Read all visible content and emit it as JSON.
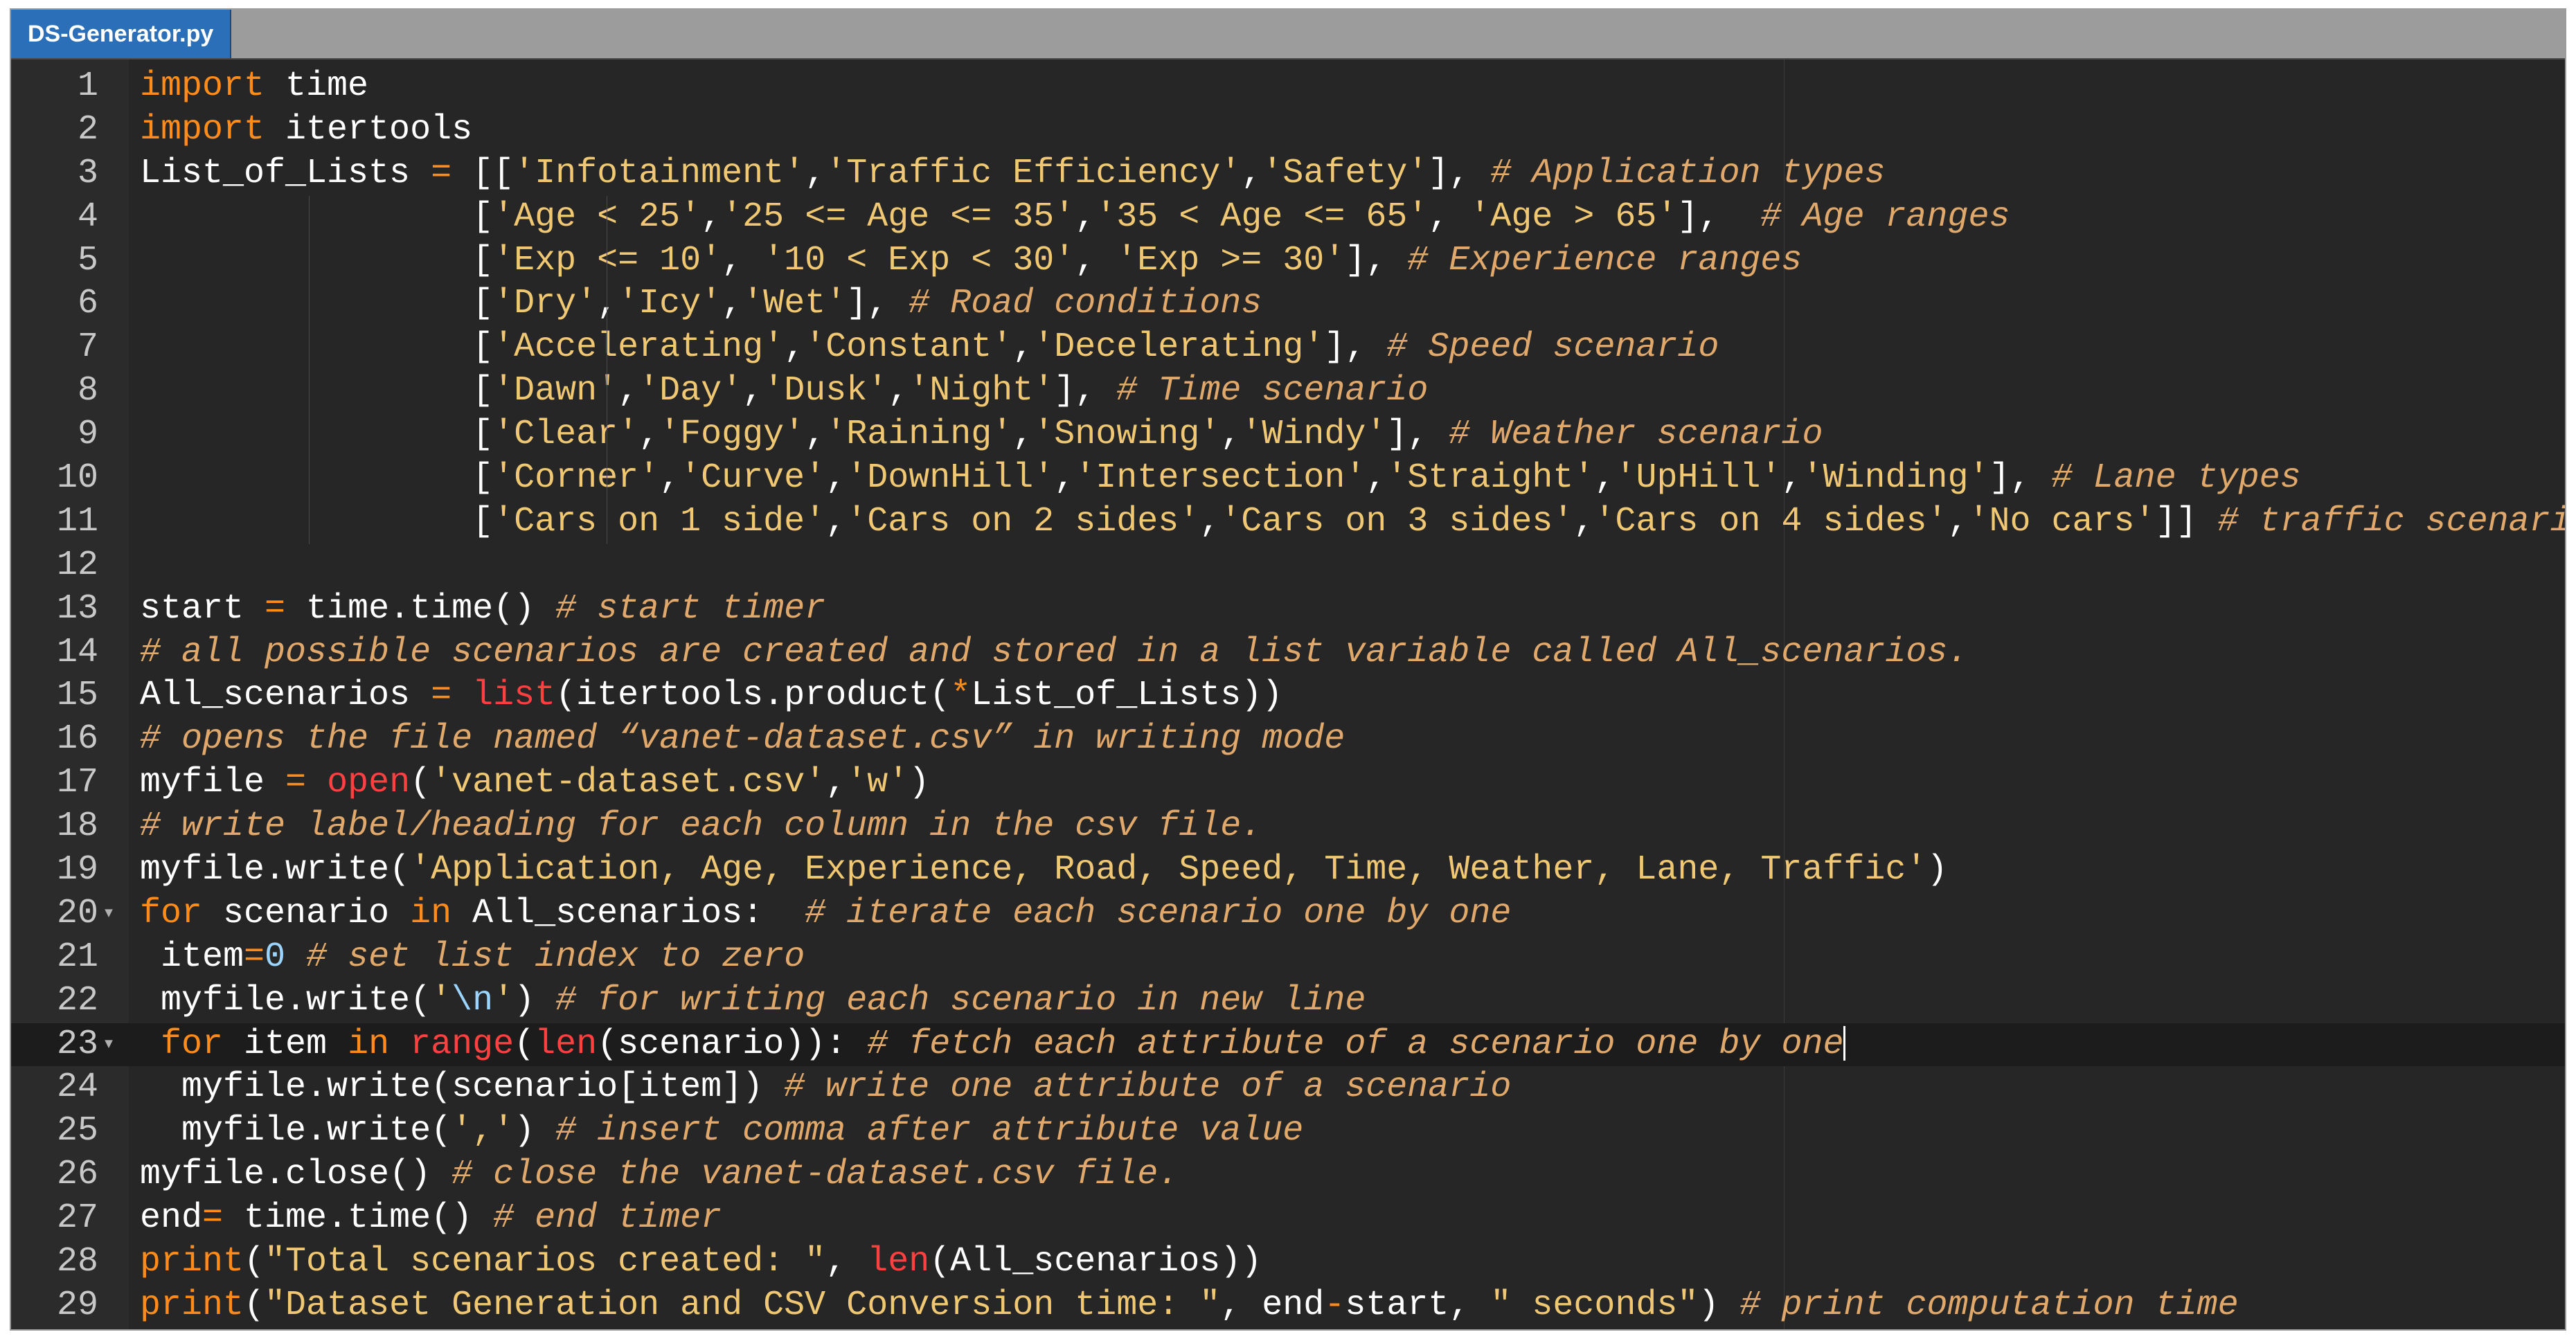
{
  "tab": {
    "filename": "DS-Generator.py"
  },
  "colors": {
    "keyword": "#ff8c1a",
    "string": "#f0c873",
    "comment": "#e0a86b",
    "builtin": "#ff4040",
    "number": "#9ad4ff",
    "background": "#262626",
    "tab_active": "#2a6fb8"
  },
  "editor": {
    "current_line": 23,
    "fold_markers": [
      20,
      23
    ],
    "lines": [
      [
        {
          "t": "import",
          "c": "kw"
        },
        {
          "t": " time"
        }
      ],
      [
        {
          "t": "import",
          "c": "kw"
        },
        {
          "t": " itertools"
        }
      ],
      [
        {
          "t": "List_of_Lists "
        },
        {
          "t": "=",
          "c": "op"
        },
        {
          "t": " [["
        },
        {
          "t": "'Infotainment'",
          "c": "str"
        },
        {
          "t": ","
        },
        {
          "t": "'Traffic Efficiency'",
          "c": "str"
        },
        {
          "t": ","
        },
        {
          "t": "'Safety'",
          "c": "str"
        },
        {
          "t": "], "
        },
        {
          "t": "# Application types",
          "c": "com"
        }
      ],
      [
        {
          "t": "                ["
        },
        {
          "t": "'Age < 25'",
          "c": "str"
        },
        {
          "t": ","
        },
        {
          "t": "'25 <= Age <= 35'",
          "c": "str"
        },
        {
          "t": ","
        },
        {
          "t": "'35 < Age <= 65'",
          "c": "str"
        },
        {
          "t": ", "
        },
        {
          "t": "'Age > 65'",
          "c": "str"
        },
        {
          "t": "],  "
        },
        {
          "t": "# Age ranges",
          "c": "com"
        }
      ],
      [
        {
          "t": "                ["
        },
        {
          "t": "'Exp <= 10'",
          "c": "str"
        },
        {
          "t": ", "
        },
        {
          "t": "'10 < Exp < 30'",
          "c": "str"
        },
        {
          "t": ", "
        },
        {
          "t": "'Exp >= 30'",
          "c": "str"
        },
        {
          "t": "], "
        },
        {
          "t": "# Experience ranges",
          "c": "com"
        }
      ],
      [
        {
          "t": "                ["
        },
        {
          "t": "'Dry'",
          "c": "str"
        },
        {
          "t": ","
        },
        {
          "t": "'Icy'",
          "c": "str"
        },
        {
          "t": ","
        },
        {
          "t": "'Wet'",
          "c": "str"
        },
        {
          "t": "], "
        },
        {
          "t": "# Road conditions",
          "c": "com"
        }
      ],
      [
        {
          "t": "                ["
        },
        {
          "t": "'Accelerating'",
          "c": "str"
        },
        {
          "t": ","
        },
        {
          "t": "'Constant'",
          "c": "str"
        },
        {
          "t": ","
        },
        {
          "t": "'Decelerating'",
          "c": "str"
        },
        {
          "t": "], "
        },
        {
          "t": "# Speed scenario",
          "c": "com"
        }
      ],
      [
        {
          "t": "                ["
        },
        {
          "t": "'Dawn'",
          "c": "str"
        },
        {
          "t": ","
        },
        {
          "t": "'Day'",
          "c": "str"
        },
        {
          "t": ","
        },
        {
          "t": "'Dusk'",
          "c": "str"
        },
        {
          "t": ","
        },
        {
          "t": "'Night'",
          "c": "str"
        },
        {
          "t": "], "
        },
        {
          "t": "# Time scenario",
          "c": "com"
        }
      ],
      [
        {
          "t": "                ["
        },
        {
          "t": "'Clear'",
          "c": "str"
        },
        {
          "t": ","
        },
        {
          "t": "'Foggy'",
          "c": "str"
        },
        {
          "t": ","
        },
        {
          "t": "'Raining'",
          "c": "str"
        },
        {
          "t": ","
        },
        {
          "t": "'Snowing'",
          "c": "str"
        },
        {
          "t": ","
        },
        {
          "t": "'Windy'",
          "c": "str"
        },
        {
          "t": "], "
        },
        {
          "t": "# Weather scenario",
          "c": "com"
        }
      ],
      [
        {
          "t": "                ["
        },
        {
          "t": "'Corner'",
          "c": "str"
        },
        {
          "t": ","
        },
        {
          "t": "'Curve'",
          "c": "str"
        },
        {
          "t": ","
        },
        {
          "t": "'DownHill'",
          "c": "str"
        },
        {
          "t": ","
        },
        {
          "t": "'Intersection'",
          "c": "str"
        },
        {
          "t": ","
        },
        {
          "t": "'Straight'",
          "c": "str"
        },
        {
          "t": ","
        },
        {
          "t": "'UpHill'",
          "c": "str"
        },
        {
          "t": ","
        },
        {
          "t": "'Winding'",
          "c": "str"
        },
        {
          "t": "], "
        },
        {
          "t": "# Lane types",
          "c": "com"
        }
      ],
      [
        {
          "t": "                ["
        },
        {
          "t": "'Cars on 1 side'",
          "c": "str"
        },
        {
          "t": ","
        },
        {
          "t": "'Cars on 2 sides'",
          "c": "str"
        },
        {
          "t": ","
        },
        {
          "t": "'Cars on 3 sides'",
          "c": "str"
        },
        {
          "t": ","
        },
        {
          "t": "'Cars on 4 sides'",
          "c": "str"
        },
        {
          "t": ","
        },
        {
          "t": "'No cars'",
          "c": "str"
        },
        {
          "t": "]] "
        },
        {
          "t": "# traffic scenario",
          "c": "com"
        }
      ],
      [],
      [
        {
          "t": "start "
        },
        {
          "t": "=",
          "c": "op"
        },
        {
          "t": " time.time() "
        },
        {
          "t": "# start timer",
          "c": "com"
        }
      ],
      [
        {
          "t": "# all possible scenarios are created and stored in a list variable called All_scenarios.",
          "c": "com"
        }
      ],
      [
        {
          "t": "All_scenarios "
        },
        {
          "t": "=",
          "c": "op"
        },
        {
          "t": " "
        },
        {
          "t": "list",
          "c": "bi"
        },
        {
          "t": "(itertools.product("
        },
        {
          "t": "*",
          "c": "op"
        },
        {
          "t": "List_of_Lists))"
        }
      ],
      [
        {
          "t": "# opens the file named “vanet-dataset.csv” in writing mode",
          "c": "com"
        }
      ],
      [
        {
          "t": "myfile "
        },
        {
          "t": "=",
          "c": "op"
        },
        {
          "t": " "
        },
        {
          "t": "open",
          "c": "bi"
        },
        {
          "t": "("
        },
        {
          "t": "'vanet-dataset.csv'",
          "c": "str"
        },
        {
          "t": ","
        },
        {
          "t": "'w'",
          "c": "str"
        },
        {
          "t": ")"
        }
      ],
      [
        {
          "t": "# write label/heading for each column in the csv file.",
          "c": "com"
        }
      ],
      [
        {
          "t": "myfile.write("
        },
        {
          "t": "'Application, Age, Experience, Road, Speed, Time, Weather, Lane, Traffic'",
          "c": "str"
        },
        {
          "t": ")"
        }
      ],
      [
        {
          "t": "for",
          "c": "kw"
        },
        {
          "t": " scenario "
        },
        {
          "t": "in",
          "c": "kw"
        },
        {
          "t": " All_scenarios:  "
        },
        {
          "t": "# iterate each scenario one by one",
          "c": "com"
        }
      ],
      [
        {
          "t": " item"
        },
        {
          "t": "=",
          "c": "op"
        },
        {
          "t": "0",
          "c": "num"
        },
        {
          "t": " "
        },
        {
          "t": "# set list index to zero",
          "c": "com"
        }
      ],
      [
        {
          "t": " myfile.write("
        },
        {
          "t": "'",
          "c": "str"
        },
        {
          "t": "\\n",
          "c": "esc"
        },
        {
          "t": "'",
          "c": "str"
        },
        {
          "t": ") "
        },
        {
          "t": "# for writing each scenario in new line",
          "c": "com"
        }
      ],
      [
        {
          "t": " "
        },
        {
          "t": "for",
          "c": "kw"
        },
        {
          "t": " item "
        },
        {
          "t": "in",
          "c": "kw"
        },
        {
          "t": " "
        },
        {
          "t": "range",
          "c": "bi"
        },
        {
          "t": "("
        },
        {
          "t": "len",
          "c": "bi"
        },
        {
          "t": "(scenario)): "
        },
        {
          "t": "# fetch each attribute of a scenario one by one",
          "c": "com"
        },
        {
          "t": "",
          "c": "cursor"
        }
      ],
      [
        {
          "t": "  myfile.write(scenario[item]) "
        },
        {
          "t": "# write one attribute of a scenario",
          "c": "com"
        }
      ],
      [
        {
          "t": "  myfile.write("
        },
        {
          "t": "','",
          "c": "str"
        },
        {
          "t": ") "
        },
        {
          "t": "# insert comma after attribute value",
          "c": "com"
        }
      ],
      [
        {
          "t": "myfile.close() "
        },
        {
          "t": "# close the vanet-dataset.csv file.",
          "c": "com"
        }
      ],
      [
        {
          "t": "end"
        },
        {
          "t": "=",
          "c": "op"
        },
        {
          "t": " time.time() "
        },
        {
          "t": "# end timer",
          "c": "com"
        }
      ],
      [
        {
          "t": "print",
          "c": "kw"
        },
        {
          "t": "("
        },
        {
          "t": "\"Total scenarios created: \"",
          "c": "str"
        },
        {
          "t": ", "
        },
        {
          "t": "len",
          "c": "bi"
        },
        {
          "t": "(All_scenarios))"
        }
      ],
      [
        {
          "t": "print",
          "c": "kw"
        },
        {
          "t": "("
        },
        {
          "t": "\"Dataset Generation and CSV Conversion time: \"",
          "c": "str"
        },
        {
          "t": ", end"
        },
        {
          "t": "-",
          "c": "op"
        },
        {
          "t": "start, "
        },
        {
          "t": "\" seconds\"",
          "c": "str"
        },
        {
          "t": ") "
        },
        {
          "t": "# print computation time",
          "c": "com"
        }
      ]
    ]
  }
}
